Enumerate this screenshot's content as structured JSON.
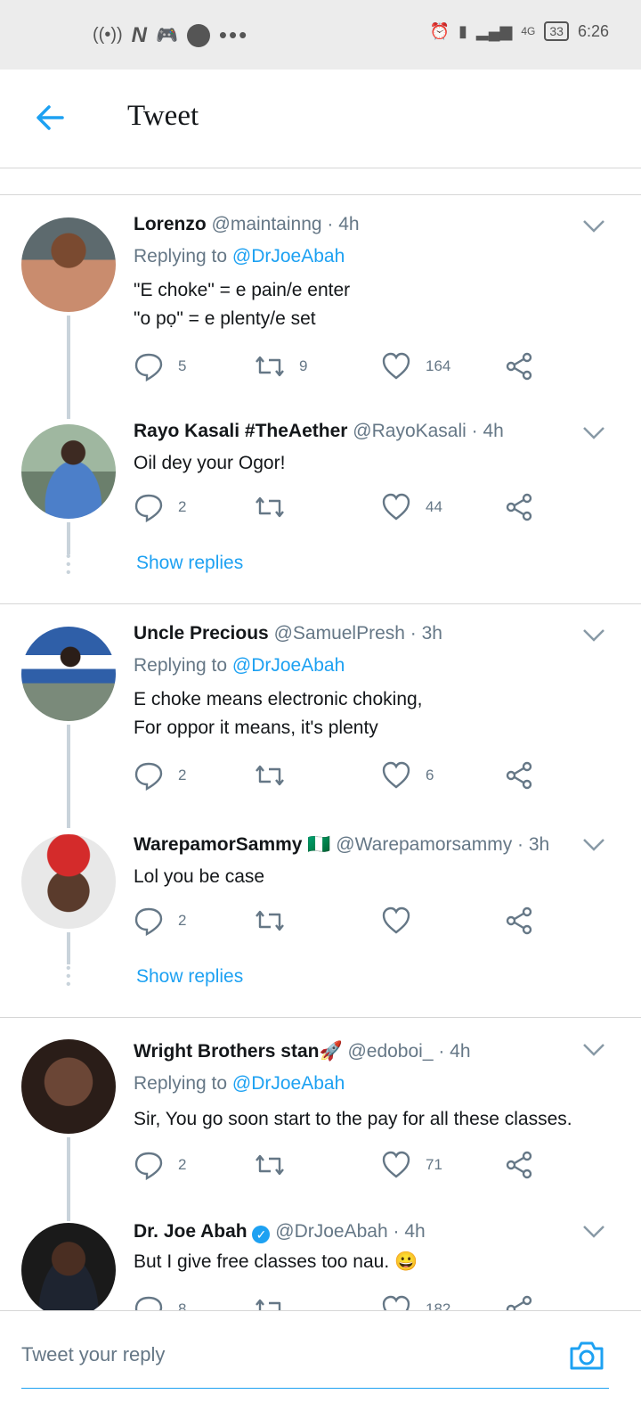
{
  "status_bar": {
    "time": "6:26",
    "battery": "33",
    "network": "4G",
    "left_icons": [
      "nfc-icon",
      "n-icon",
      "game-icon",
      "circle-icon",
      "more-icon"
    ]
  },
  "header": {
    "title": "Tweet"
  },
  "colors": {
    "accent": "#1da1f2",
    "secondary_text": "#657786",
    "thread_line": "#c9d3db"
  },
  "tweets": [
    {
      "name": "Lorenzo",
      "handle": "@maintainng · 4h",
      "replying_prefix": "Replying to",
      "replying_to": "@DrJoeAbah",
      "lines": [
        "\"E choke\" = e pain/e enter",
        "\"o pọ\" = e plenty/e set"
      ],
      "replies": "5",
      "retweets": "9",
      "likes": "164"
    },
    {
      "name": "Rayo Kasali #TheAether",
      "handle": "@RayoKasali · 4h",
      "lines": [
        "Oil dey your Ogor!"
      ],
      "replies": "2",
      "retweets": "",
      "likes": "44",
      "show_replies": "Show replies"
    },
    {
      "name": "Uncle Precious",
      "handle": "@SamuelPresh · 3h",
      "replying_prefix": "Replying to",
      "replying_to": "@DrJoeAbah",
      "lines": [
        "E choke means electronic choking,",
        "For oppor it means, it's plenty"
      ],
      "replies": "2",
      "retweets": "",
      "likes": "6"
    },
    {
      "name": "WarepamorSammy 🇳🇬",
      "handle": "@Warepamorsammy · 3h",
      "lines": [
        "Lol you be case"
      ],
      "replies": "2",
      "retweets": "",
      "likes": "",
      "show_replies": "Show replies"
    },
    {
      "name": "Wright Brothers stan🚀",
      "handle": "@edoboi_ · 4h",
      "replying_prefix": "Replying to",
      "replying_to": "@DrJoeAbah",
      "lines": [
        "Sir, You go soon start to the pay for all these classes."
      ],
      "replies": "2",
      "retweets": "",
      "likes": "71"
    },
    {
      "name": "Dr. Joe Abah",
      "handle": "@DrJoeAbah · 4h",
      "lines": [
        "But I give free classes too nau. 😀"
      ],
      "replies": "8",
      "retweets": "",
      "likes": "182"
    }
  ],
  "reply_box": {
    "placeholder": "Tweet your reply"
  }
}
